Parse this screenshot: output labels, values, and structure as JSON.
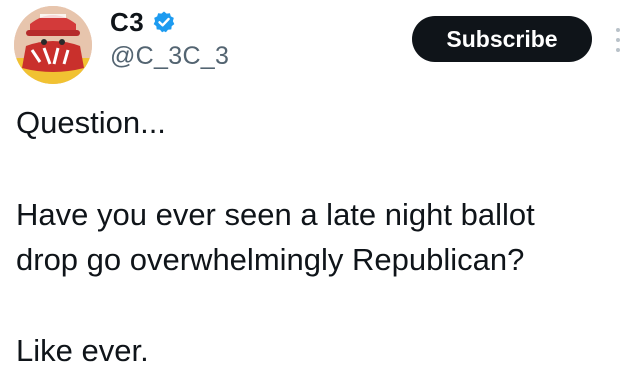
{
  "author": {
    "display_name": "C3",
    "handle": "@C_3C_3",
    "verified": true,
    "verified_color": "#1d9bf0",
    "avatar_icon": "avatar-photo"
  },
  "actions": {
    "subscribe_label": "Subscribe",
    "subscribe_bg": "#0f1419",
    "more_icon": "more-vertical-icon"
  },
  "tweet": {
    "lines": [
      "Question...",
      "Have you ever seen a late night ballot",
      "drop go overwhelmingly Republican?",
      "Like ever."
    ]
  }
}
